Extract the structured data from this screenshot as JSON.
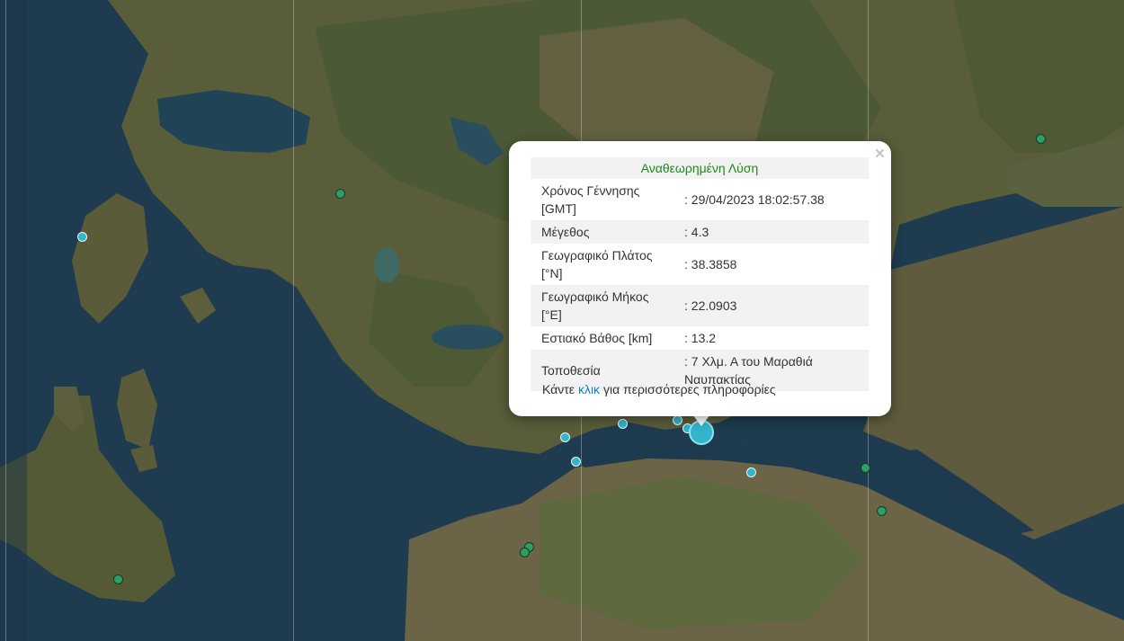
{
  "popup": {
    "title": "Αναθεωρημένη Λύση",
    "rows": [
      {
        "label": "Χρόνος Γέννησης [GMT]",
        "value": ": 29/04/2023 18:02:57.38"
      },
      {
        "label": "Μέγεθος",
        "value": ": 4.3"
      },
      {
        "label": "Γεωγραφικό Πλάτος [°N]",
        "value": ": 38.3858"
      },
      {
        "label": "Γεωγραφικό Μήκος [°E]",
        "value": ": 22.0903"
      },
      {
        "label": "Εστιακό Βάθος [km]",
        "value": ": 13.2"
      },
      {
        "label": "Τοποθεσία",
        "value": ": 7 Χλμ. Α του Μαραθιά Ναυπακτίας"
      }
    ],
    "more_prefix": "Κάντε",
    "more_link": "κλικ",
    "more_suffix": "για περισσότερες πληροφορίες",
    "close_symbol": "×"
  },
  "colors": {
    "marker_green": "#2e9e64",
    "marker_cyan": "#33b5cc",
    "title_green": "#1a8a1a",
    "link_blue": "#1a7fb3"
  }
}
